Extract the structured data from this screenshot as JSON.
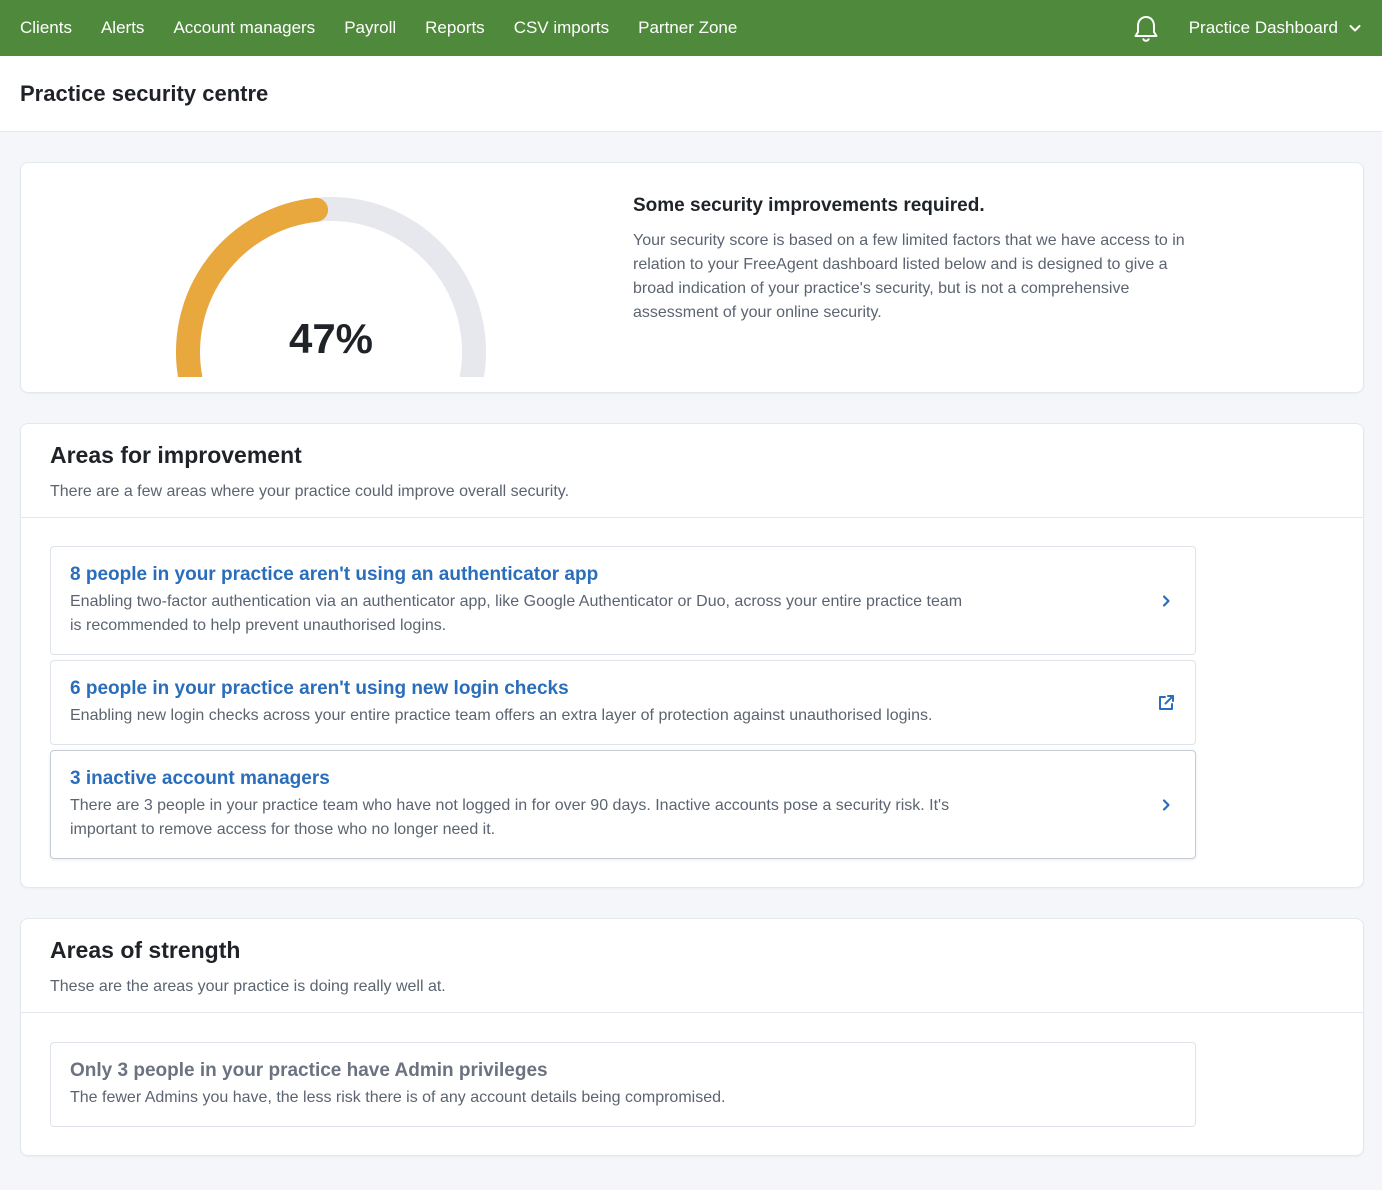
{
  "nav": {
    "links": [
      "Clients",
      "Alerts",
      "Account managers",
      "Payroll",
      "Reports",
      "CSV imports",
      "Partner Zone"
    ],
    "dashboard_label": "Practice Dashboard",
    "bell_icon": "bell-icon",
    "chevron_icon": "chevron-down-icon",
    "bg_color": "#4f8a3c"
  },
  "page": {
    "title": "Practice security centre"
  },
  "score": {
    "percent": 47,
    "label": "47%",
    "heading": "Some security improvements required.",
    "description": "Your security score is based on a few limited factors that we have access to in relation to your FreeAgent dashboard listed below and is designed to give a broad indication of your practice's security, but is not a comprehensive assessment of your online security.",
    "fill_color": "#e8a83e",
    "track_color": "#e6e8ed"
  },
  "improvement": {
    "title": "Areas for improvement",
    "subtitle": "There are a few areas where your practice could improve overall security.",
    "items": [
      {
        "title": "8 people in your practice aren't using an authenticator app",
        "desc": "Enabling two-factor authentication via an authenticator app, like Google Authenticator or Duo, across your entire practice team is recommended to help prevent unauthorised logins.",
        "icon": "chevron-right-icon"
      },
      {
        "title": "6 people in your practice aren't using new login checks",
        "desc": "Enabling new login checks across your entire practice team offers an extra layer of protection against unauthorised logins.",
        "icon": "external-link-icon"
      },
      {
        "title": "3 inactive account managers",
        "desc": "There are 3 people in your practice team who have not logged in for over 90 days. Inactive accounts pose a security risk. It's important to remove access for those who no longer need it.",
        "icon": "chevron-right-icon"
      }
    ]
  },
  "strength": {
    "title": "Areas of strength",
    "subtitle": "These are the areas your practice is doing really well at.",
    "items": [
      {
        "title": "Only 3 people in your practice have Admin privileges",
        "desc": "The fewer Admins you have, the less risk there is of any account details being compromised."
      }
    ]
  }
}
